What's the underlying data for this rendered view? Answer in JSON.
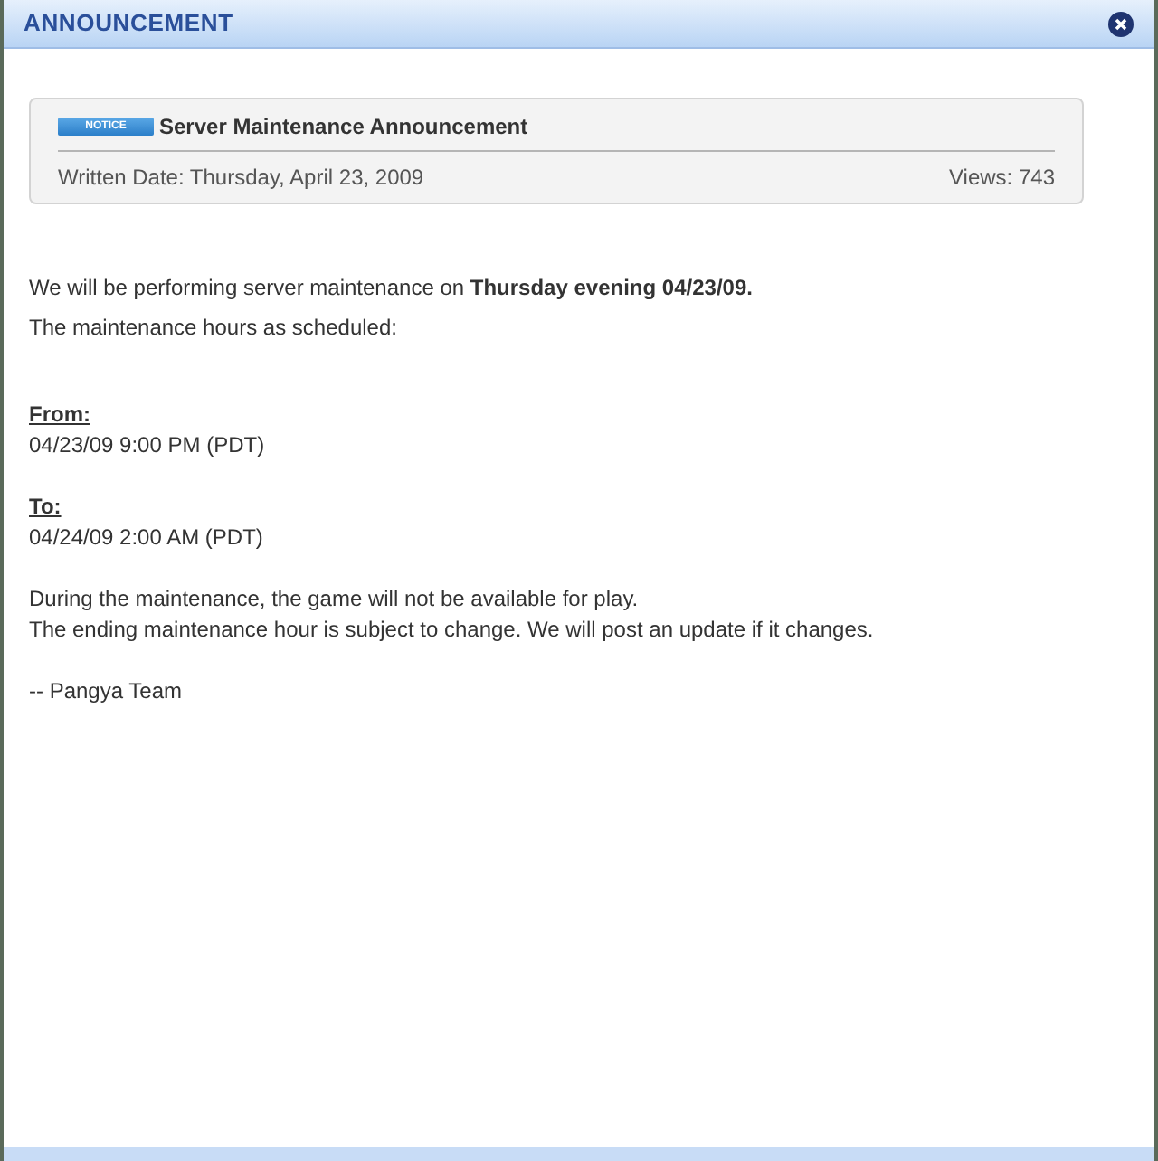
{
  "window": {
    "title": "ANNOUNCEMENT"
  },
  "post": {
    "badge": "NOTICE",
    "title": "Server Maintenance Announcement",
    "written_date": "Written Date: Thursday, April 23, 2009",
    "views": "Views: 743"
  },
  "body": [
    {
      "kind": "text",
      "lines": [
        "We will be performing server maintenance on **Thursday evening 04/23/09.**",
        "The maintenance hours as scheduled:"
      ]
    },
    {
      "kind": "heading",
      "text": "From:",
      "lines": [
        "04/23/09 9:00 PM (PDT)"
      ]
    },
    {
      "kind": "heading",
      "text": "To:",
      "lines": [
        "04/24/09 2:00 AM (PDT)"
      ]
    },
    {
      "kind": "text",
      "lines": [
        "During the maintenance, the game will not be available for play.",
        "The ending maintenance hour is subject to change. We will post an update if it changes."
      ]
    },
    {
      "kind": "text",
      "lines": [
        "-- Pangya Team"
      ]
    }
  ]
}
